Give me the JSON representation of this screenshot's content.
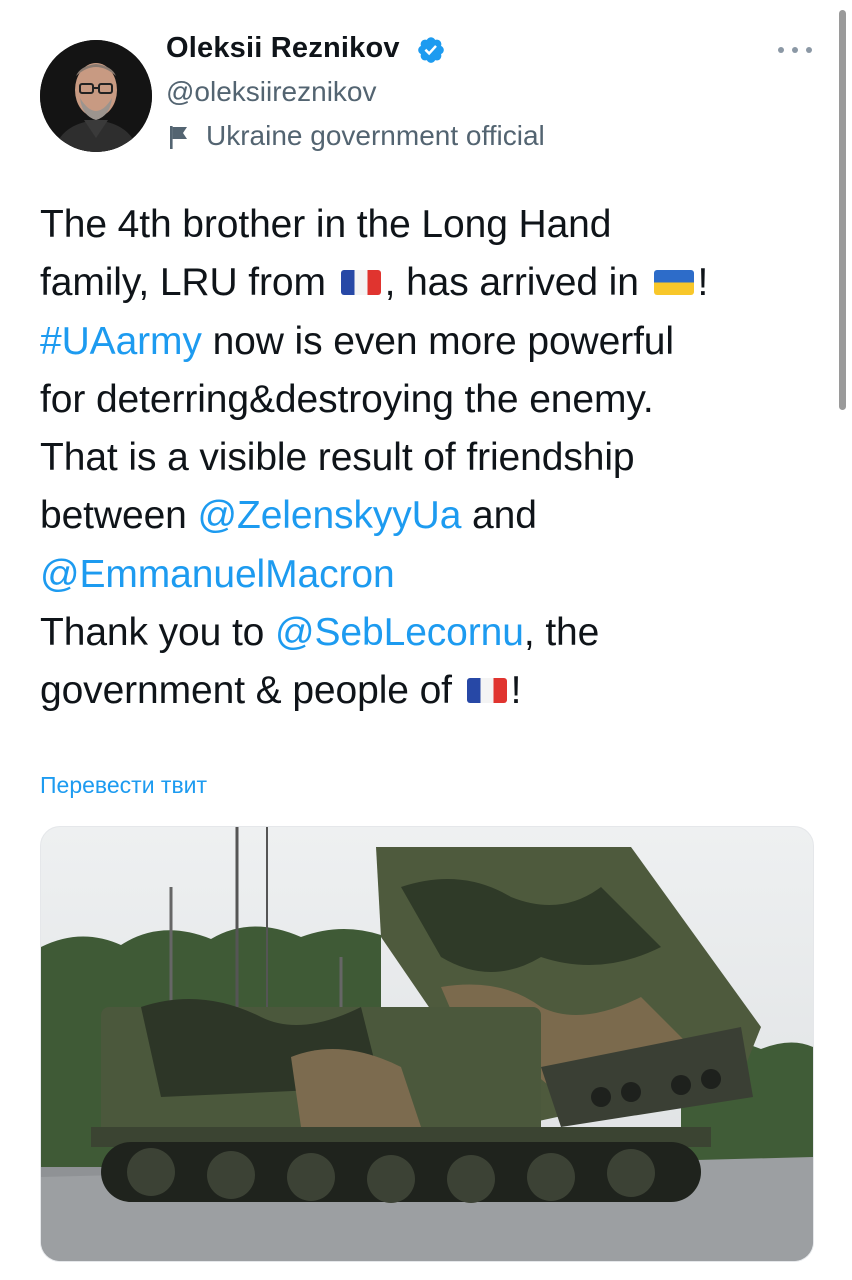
{
  "author": {
    "name": "Oleksii Reznikov",
    "handle": "@oleksiireznikov",
    "label": "Ukraine government official",
    "verified_color": "#1d9bf0"
  },
  "menu": {
    "icon": "more-horizontal-icon"
  },
  "tweet": {
    "lines": [
      [
        {
          "t": "text",
          "v": "The 4th brother in the Long Hand"
        }
      ],
      [
        {
          "t": "text",
          "v": "family, LRU from "
        },
        {
          "t": "emoji",
          "v": "fr"
        },
        {
          "t": "text",
          "v": ", has arrived in "
        },
        {
          "t": "emoji",
          "v": "ua"
        },
        {
          "t": "text",
          "v": "!"
        }
      ],
      [
        {
          "t": "link",
          "v": "#UAarmy"
        },
        {
          "t": "text",
          "v": " now is even more powerful"
        }
      ],
      [
        {
          "t": "text",
          "v": "for deterring&destroying the enemy."
        }
      ],
      [
        {
          "t": "text",
          "v": "That is a visible result of friendship"
        }
      ],
      [
        {
          "t": "text",
          "v": "between "
        },
        {
          "t": "link",
          "v": "@ZelenskyyUa"
        },
        {
          "t": "text",
          "v": " and"
        }
      ],
      [
        {
          "t": "link",
          "v": "@EmmanuelMacron"
        }
      ],
      [
        {
          "t": "text",
          "v": "Thank you to "
        },
        {
          "t": "link",
          "v": "@SebLecornu"
        },
        {
          "t": "text",
          "v": ", the"
        }
      ],
      [
        {
          "t": "text",
          "v": "government & people of "
        },
        {
          "t": "emoji",
          "v": "fr"
        },
        {
          "t": "text",
          "v": "!"
        }
      ]
    ]
  },
  "translate_label": "Перевести твит",
  "media": {
    "subject": "tracked-rocket-launcher-photo"
  },
  "colors": {
    "link": "#1d9bf0",
    "secondary": "#536471",
    "text": "#0f1419"
  }
}
